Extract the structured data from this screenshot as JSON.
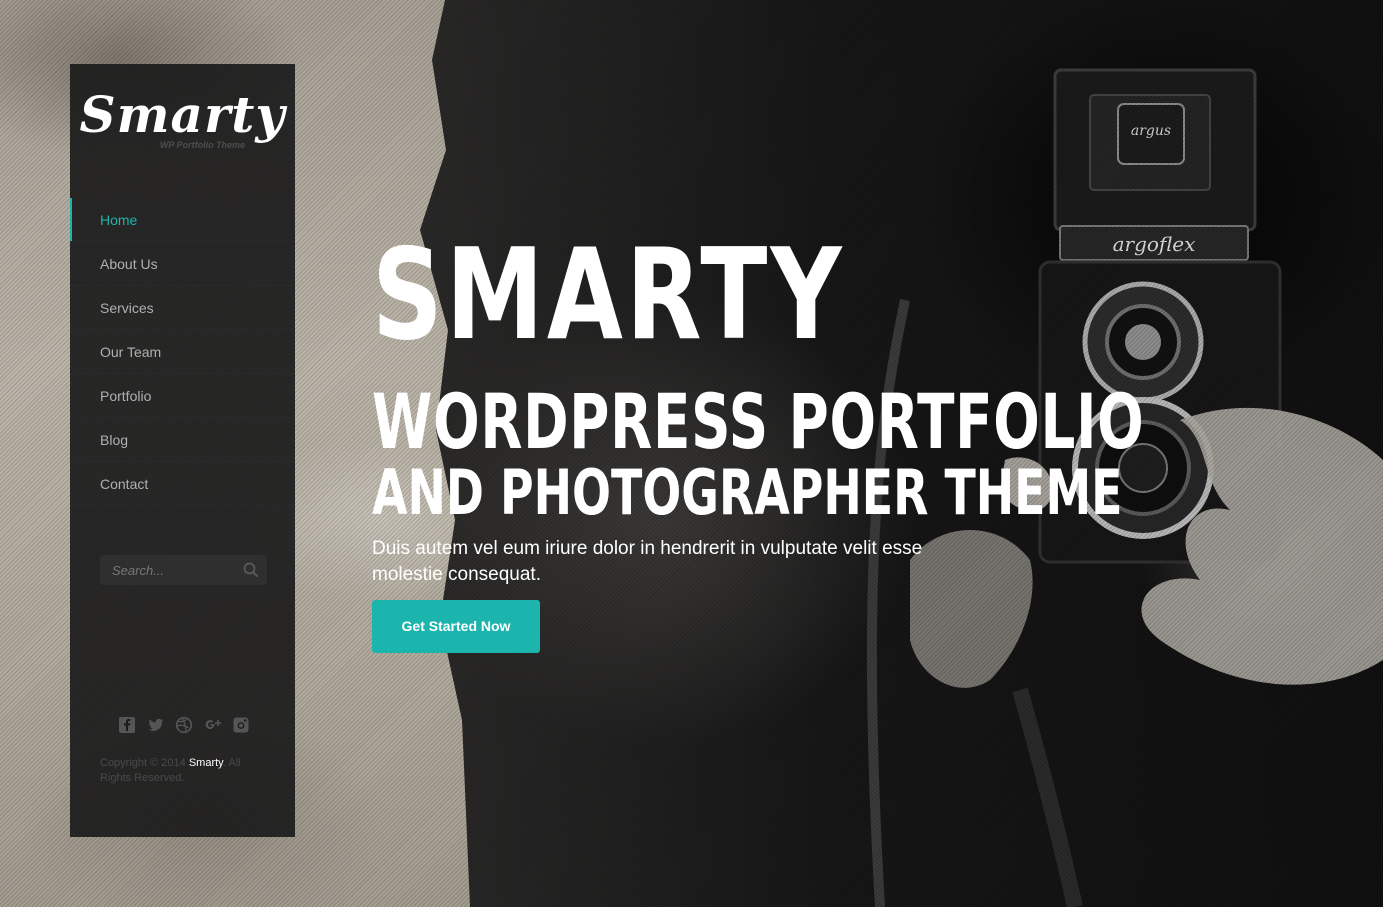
{
  "colors": {
    "accent": "#1cb5ad",
    "sidebar_bg": "#1c1c1c",
    "text_light": "#ffffff"
  },
  "logo": {
    "text": "Smarty",
    "tagline": "WP Portfolio Theme"
  },
  "nav": {
    "items": [
      {
        "label": "Home",
        "active": true
      },
      {
        "label": "About Us",
        "active": false
      },
      {
        "label": "Services",
        "active": false
      },
      {
        "label": "Our Team",
        "active": false
      },
      {
        "label": "Portfolio",
        "active": false
      },
      {
        "label": "Blog",
        "active": false
      },
      {
        "label": "Contact",
        "active": false
      }
    ]
  },
  "search": {
    "placeholder": "Search..."
  },
  "social": {
    "icons": [
      "facebook-icon",
      "twitter-icon",
      "dribbble-icon",
      "google-plus-icon",
      "instagram-icon"
    ]
  },
  "footer": {
    "copyright_prefix": "Copyright © 2014",
    "brand": "Smarty",
    "copyright_suffix": ". All Rights Reserved."
  },
  "hero": {
    "title": "SMARTY",
    "subtitle_line1": "WORDPRESS PORTFOLIO",
    "subtitle_line2": "AND PHOTOGRAPHER THEME",
    "description": "Duis autem vel eum iriure dolor in hendrerit in vulputate velit esse molestie consequat.",
    "cta_label": "Get Started Now"
  },
  "camera": {
    "brand_top": "argus",
    "brand_plate": "argoflex"
  }
}
